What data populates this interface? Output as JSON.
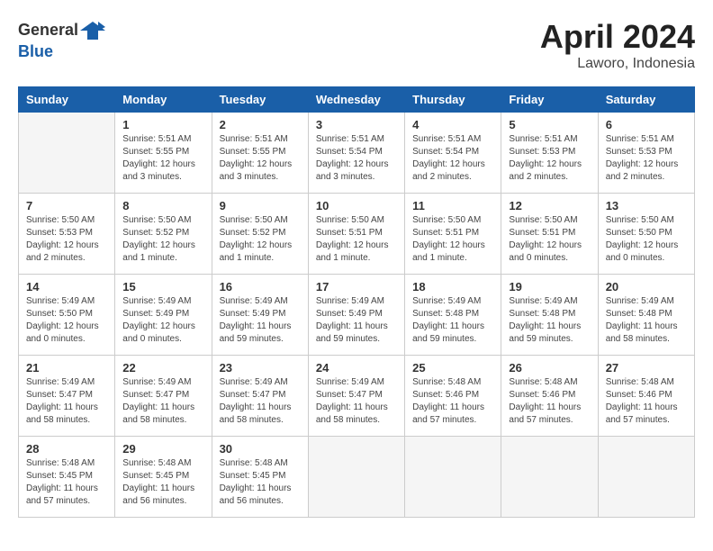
{
  "logo": {
    "general": "General",
    "blue": "Blue"
  },
  "title": "April 2024",
  "location": "Laworo, Indonesia",
  "days_header": [
    "Sunday",
    "Monday",
    "Tuesday",
    "Wednesday",
    "Thursday",
    "Friday",
    "Saturday"
  ],
  "weeks": [
    [
      {
        "num": "",
        "info": ""
      },
      {
        "num": "1",
        "info": "Sunrise: 5:51 AM\nSunset: 5:55 PM\nDaylight: 12 hours\nand 3 minutes."
      },
      {
        "num": "2",
        "info": "Sunrise: 5:51 AM\nSunset: 5:55 PM\nDaylight: 12 hours\nand 3 minutes."
      },
      {
        "num": "3",
        "info": "Sunrise: 5:51 AM\nSunset: 5:54 PM\nDaylight: 12 hours\nand 3 minutes."
      },
      {
        "num": "4",
        "info": "Sunrise: 5:51 AM\nSunset: 5:54 PM\nDaylight: 12 hours\nand 2 minutes."
      },
      {
        "num": "5",
        "info": "Sunrise: 5:51 AM\nSunset: 5:53 PM\nDaylight: 12 hours\nand 2 minutes."
      },
      {
        "num": "6",
        "info": "Sunrise: 5:51 AM\nSunset: 5:53 PM\nDaylight: 12 hours\nand 2 minutes."
      }
    ],
    [
      {
        "num": "7",
        "info": "Sunrise: 5:50 AM\nSunset: 5:53 PM\nDaylight: 12 hours\nand 2 minutes."
      },
      {
        "num": "8",
        "info": "Sunrise: 5:50 AM\nSunset: 5:52 PM\nDaylight: 12 hours\nand 1 minute."
      },
      {
        "num": "9",
        "info": "Sunrise: 5:50 AM\nSunset: 5:52 PM\nDaylight: 12 hours\nand 1 minute."
      },
      {
        "num": "10",
        "info": "Sunrise: 5:50 AM\nSunset: 5:51 PM\nDaylight: 12 hours\nand 1 minute."
      },
      {
        "num": "11",
        "info": "Sunrise: 5:50 AM\nSunset: 5:51 PM\nDaylight: 12 hours\nand 1 minute."
      },
      {
        "num": "12",
        "info": "Sunrise: 5:50 AM\nSunset: 5:51 PM\nDaylight: 12 hours\nand 0 minutes."
      },
      {
        "num": "13",
        "info": "Sunrise: 5:50 AM\nSunset: 5:50 PM\nDaylight: 12 hours\nand 0 minutes."
      }
    ],
    [
      {
        "num": "14",
        "info": "Sunrise: 5:49 AM\nSunset: 5:50 PM\nDaylight: 12 hours\nand 0 minutes."
      },
      {
        "num": "15",
        "info": "Sunrise: 5:49 AM\nSunset: 5:49 PM\nDaylight: 12 hours\nand 0 minutes."
      },
      {
        "num": "16",
        "info": "Sunrise: 5:49 AM\nSunset: 5:49 PM\nDaylight: 11 hours\nand 59 minutes."
      },
      {
        "num": "17",
        "info": "Sunrise: 5:49 AM\nSunset: 5:49 PM\nDaylight: 11 hours\nand 59 minutes."
      },
      {
        "num": "18",
        "info": "Sunrise: 5:49 AM\nSunset: 5:48 PM\nDaylight: 11 hours\nand 59 minutes."
      },
      {
        "num": "19",
        "info": "Sunrise: 5:49 AM\nSunset: 5:48 PM\nDaylight: 11 hours\nand 59 minutes."
      },
      {
        "num": "20",
        "info": "Sunrise: 5:49 AM\nSunset: 5:48 PM\nDaylight: 11 hours\nand 58 minutes."
      }
    ],
    [
      {
        "num": "21",
        "info": "Sunrise: 5:49 AM\nSunset: 5:47 PM\nDaylight: 11 hours\nand 58 minutes."
      },
      {
        "num": "22",
        "info": "Sunrise: 5:49 AM\nSunset: 5:47 PM\nDaylight: 11 hours\nand 58 minutes."
      },
      {
        "num": "23",
        "info": "Sunrise: 5:49 AM\nSunset: 5:47 PM\nDaylight: 11 hours\nand 58 minutes."
      },
      {
        "num": "24",
        "info": "Sunrise: 5:49 AM\nSunset: 5:47 PM\nDaylight: 11 hours\nand 58 minutes."
      },
      {
        "num": "25",
        "info": "Sunrise: 5:48 AM\nSunset: 5:46 PM\nDaylight: 11 hours\nand 57 minutes."
      },
      {
        "num": "26",
        "info": "Sunrise: 5:48 AM\nSunset: 5:46 PM\nDaylight: 11 hours\nand 57 minutes."
      },
      {
        "num": "27",
        "info": "Sunrise: 5:48 AM\nSunset: 5:46 PM\nDaylight: 11 hours\nand 57 minutes."
      }
    ],
    [
      {
        "num": "28",
        "info": "Sunrise: 5:48 AM\nSunset: 5:45 PM\nDaylight: 11 hours\nand 57 minutes."
      },
      {
        "num": "29",
        "info": "Sunrise: 5:48 AM\nSunset: 5:45 PM\nDaylight: 11 hours\nand 56 minutes."
      },
      {
        "num": "30",
        "info": "Sunrise: 5:48 AM\nSunset: 5:45 PM\nDaylight: 11 hours\nand 56 minutes."
      },
      {
        "num": "",
        "info": ""
      },
      {
        "num": "",
        "info": ""
      },
      {
        "num": "",
        "info": ""
      },
      {
        "num": "",
        "info": ""
      }
    ]
  ]
}
